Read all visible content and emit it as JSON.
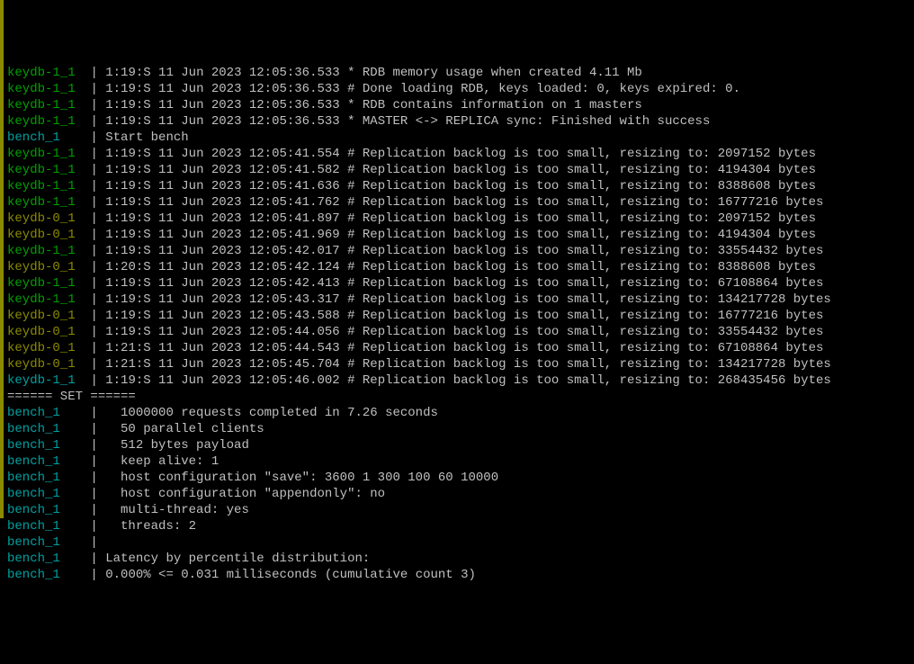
{
  "lines": [
    {
      "prefix_class": "keydb-1",
      "prefix": "keydb-1_1",
      "pad": "  ",
      "sep": "| ",
      "text": "1:19:S 11 Jun 2023 12:05:36.533 * RDB memory usage when created 4.11 Mb"
    },
    {
      "prefix_class": "keydb-1",
      "prefix": "keydb-1_1",
      "pad": "  ",
      "sep": "| ",
      "text": "1:19:S 11 Jun 2023 12:05:36.533 # Done loading RDB, keys loaded: 0, keys expired: 0."
    },
    {
      "prefix_class": "keydb-1",
      "prefix": "keydb-1_1",
      "pad": "  ",
      "sep": "| ",
      "text": "1:19:S 11 Jun 2023 12:05:36.533 * RDB contains information on 1 masters"
    },
    {
      "prefix_class": "keydb-1",
      "prefix": "keydb-1_1",
      "pad": "  ",
      "sep": "| ",
      "text": "1:19:S 11 Jun 2023 12:05:36.533 * MASTER <-> REPLICA sync: Finished with success"
    },
    {
      "prefix_class": "bench",
      "prefix": "bench_1",
      "pad": "    ",
      "sep": "| ",
      "text": "Start bench"
    },
    {
      "prefix_class": "keydb-1",
      "prefix": "keydb-1_1",
      "pad": "  ",
      "sep": "| ",
      "text": "1:19:S 11 Jun 2023 12:05:41.554 # Replication backlog is too small, resizing to: 2097152 bytes"
    },
    {
      "prefix_class": "keydb-1",
      "prefix": "keydb-1_1",
      "pad": "  ",
      "sep": "| ",
      "text": "1:19:S 11 Jun 2023 12:05:41.582 # Replication backlog is too small, resizing to: 4194304 bytes"
    },
    {
      "prefix_class": "keydb-1",
      "prefix": "keydb-1_1",
      "pad": "  ",
      "sep": "| ",
      "text": "1:19:S 11 Jun 2023 12:05:41.636 # Replication backlog is too small, resizing to: 8388608 bytes"
    },
    {
      "prefix_class": "keydb-1",
      "prefix": "keydb-1_1",
      "pad": "  ",
      "sep": "| ",
      "text": "1:19:S 11 Jun 2023 12:05:41.762 # Replication backlog is too small, resizing to: 16777216 bytes"
    },
    {
      "prefix_class": "keydb-0",
      "prefix": "keydb-0_1",
      "pad": "  ",
      "sep": "| ",
      "text": "1:19:S 11 Jun 2023 12:05:41.897 # Replication backlog is too small, resizing to: 2097152 bytes"
    },
    {
      "prefix_class": "keydb-0",
      "prefix": "keydb-0_1",
      "pad": "  ",
      "sep": "| ",
      "text": "1:19:S 11 Jun 2023 12:05:41.969 # Replication backlog is too small, resizing to: 4194304 bytes"
    },
    {
      "prefix_class": "keydb-1",
      "prefix": "keydb-1_1",
      "pad": "  ",
      "sep": "| ",
      "text": "1:19:S 11 Jun 2023 12:05:42.017 # Replication backlog is too small, resizing to: 33554432 bytes"
    },
    {
      "prefix_class": "keydb-0",
      "prefix": "keydb-0_1",
      "pad": "  ",
      "sep": "| ",
      "text": "1:20:S 11 Jun 2023 12:05:42.124 # Replication backlog is too small, resizing to: 8388608 bytes"
    },
    {
      "prefix_class": "keydb-1",
      "prefix": "keydb-1_1",
      "pad": "  ",
      "sep": "| ",
      "text": "1:19:S 11 Jun 2023 12:05:42.413 # Replication backlog is too small, resizing to: 67108864 bytes"
    },
    {
      "prefix_class": "keydb-1",
      "prefix": "keydb-1_1",
      "pad": "  ",
      "sep": "| ",
      "text": "1:19:S 11 Jun 2023 12:05:43.317 # Replication backlog is too small, resizing to: 134217728 bytes"
    },
    {
      "prefix_class": "keydb-0",
      "prefix": "keydb-0_1",
      "pad": "  ",
      "sep": "| ",
      "text": "1:19:S 11 Jun 2023 12:05:43.588 # Replication backlog is too small, resizing to: 16777216 bytes"
    },
    {
      "prefix_class": "keydb-0",
      "prefix": "keydb-0_1",
      "pad": "  ",
      "sep": "| ",
      "text": "1:19:S 11 Jun 2023 12:05:44.056 # Replication backlog is too small, resizing to: 33554432 bytes"
    },
    {
      "prefix_class": "keydb-0",
      "prefix": "keydb-0_1",
      "pad": "  ",
      "sep": "| ",
      "text": "1:21:S 11 Jun 2023 12:05:44.543 # Replication backlog is too small, resizing to: 67108864 bytes"
    },
    {
      "prefix_class": "keydb-0",
      "prefix": "keydb-0_1",
      "pad": "  ",
      "sep": "| ",
      "text": "1:21:S 11 Jun 2023 12:05:45.704 # Replication backlog is too small, resizing to: 134217728 bytes"
    },
    {
      "prefix_class": "keydb-last",
      "prefix": "keydb-1_1",
      "pad": "  ",
      "sep": "| ",
      "text": "1:19:S 11 Jun 2023 12:05:46.002 # Replication backlog is too small, resizing to: 268435456 bytes"
    },
    {
      "prefix_class": "header-line",
      "raw": "====== SET ======"
    },
    {
      "prefix_class": "bench",
      "prefix": "bench_1",
      "pad": "    ",
      "sep": "|   ",
      "text": "1000000 requests completed in 7.26 seconds"
    },
    {
      "prefix_class": "bench",
      "prefix": "bench_1",
      "pad": "    ",
      "sep": "|   ",
      "text": "50 parallel clients"
    },
    {
      "prefix_class": "bench",
      "prefix": "bench_1",
      "pad": "    ",
      "sep": "|   ",
      "text": "512 bytes payload"
    },
    {
      "prefix_class": "bench",
      "prefix": "bench_1",
      "pad": "    ",
      "sep": "|   ",
      "text": "keep alive: 1"
    },
    {
      "prefix_class": "bench",
      "prefix": "bench_1",
      "pad": "    ",
      "sep": "|   ",
      "text": "host configuration \"save\": 3600 1 300 100 60 10000"
    },
    {
      "prefix_class": "bench",
      "prefix": "bench_1",
      "pad": "    ",
      "sep": "|   ",
      "text": "host configuration \"appendonly\": no"
    },
    {
      "prefix_class": "bench",
      "prefix": "bench_1",
      "pad": "    ",
      "sep": "|   ",
      "text": "multi-thread: yes"
    },
    {
      "prefix_class": "bench",
      "prefix": "bench_1",
      "pad": "    ",
      "sep": "|   ",
      "text": "threads: 2"
    },
    {
      "prefix_class": "bench",
      "prefix": "bench_1",
      "pad": "    ",
      "sep": "| ",
      "text": ""
    },
    {
      "prefix_class": "bench",
      "prefix": "bench_1",
      "pad": "    ",
      "sep": "| ",
      "text": "Latency by percentile distribution:"
    },
    {
      "prefix_class": "bench",
      "prefix": "bench_1",
      "pad": "    ",
      "sep": "| ",
      "text": "0.000% <= 0.031 milliseconds (cumulative count 3)"
    }
  ]
}
